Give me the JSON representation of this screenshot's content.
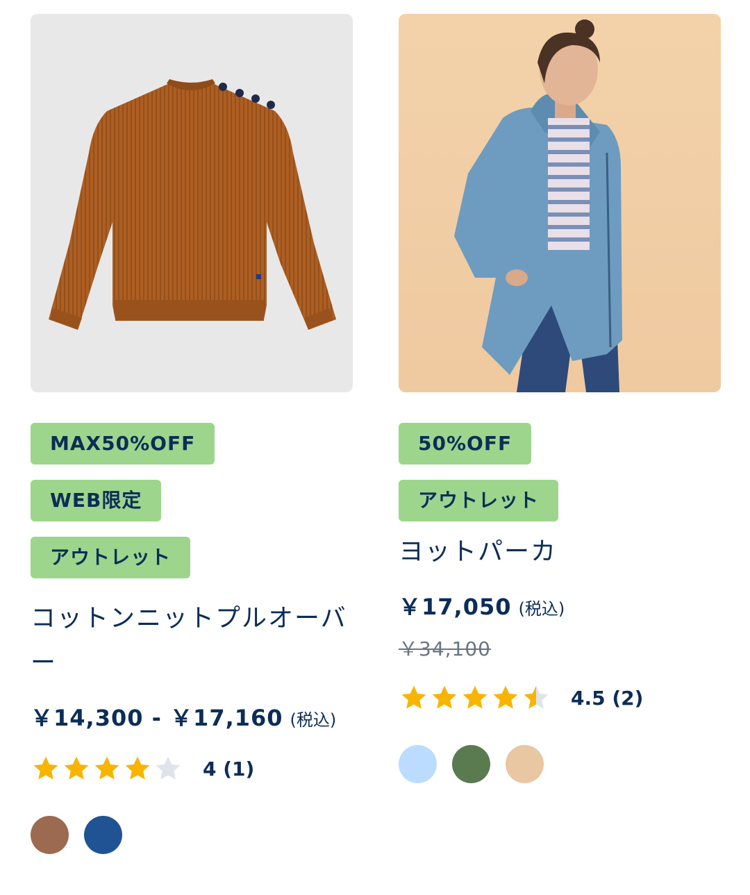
{
  "products": [
    {
      "badges": [
        "MAX50%OFF",
        "WEB限定",
        "アウトレット"
      ],
      "title": "コットンニットプルオーバー",
      "price": "￥14,300 - ￥17,160",
      "tax_label": "(税込)",
      "rating_value": 4,
      "rating_text": "4 (1)",
      "image_alt": "orange ribbed sweater product photo",
      "swatches": [
        {
          "name": "brown-swatch",
          "color": "#9c6a50"
        },
        {
          "name": "blue-swatch",
          "color": "#1f5394"
        }
      ]
    },
    {
      "badges": [
        "50%OFF",
        "アウトレット"
      ],
      "title": "ヨットパーカ",
      "price": "￥17,050",
      "tax_label": "(税込)",
      "original_price": "￥34,100",
      "rating_value": 4.5,
      "rating_text": "4.5 (2)",
      "image_alt": "model wearing blue rain parka",
      "swatches": [
        {
          "name": "light-blue-swatch",
          "color": "#bcdcff"
        },
        {
          "name": "green-swatch",
          "color": "#5a7a50"
        },
        {
          "name": "beige-swatch",
          "color": "#e9c7a2"
        }
      ]
    }
  ],
  "colors": {
    "badge_bg": "#9dd58c",
    "text_navy": "#0c2d57",
    "star_filled": "#f7b500",
    "star_empty": "#dfe3ea"
  }
}
